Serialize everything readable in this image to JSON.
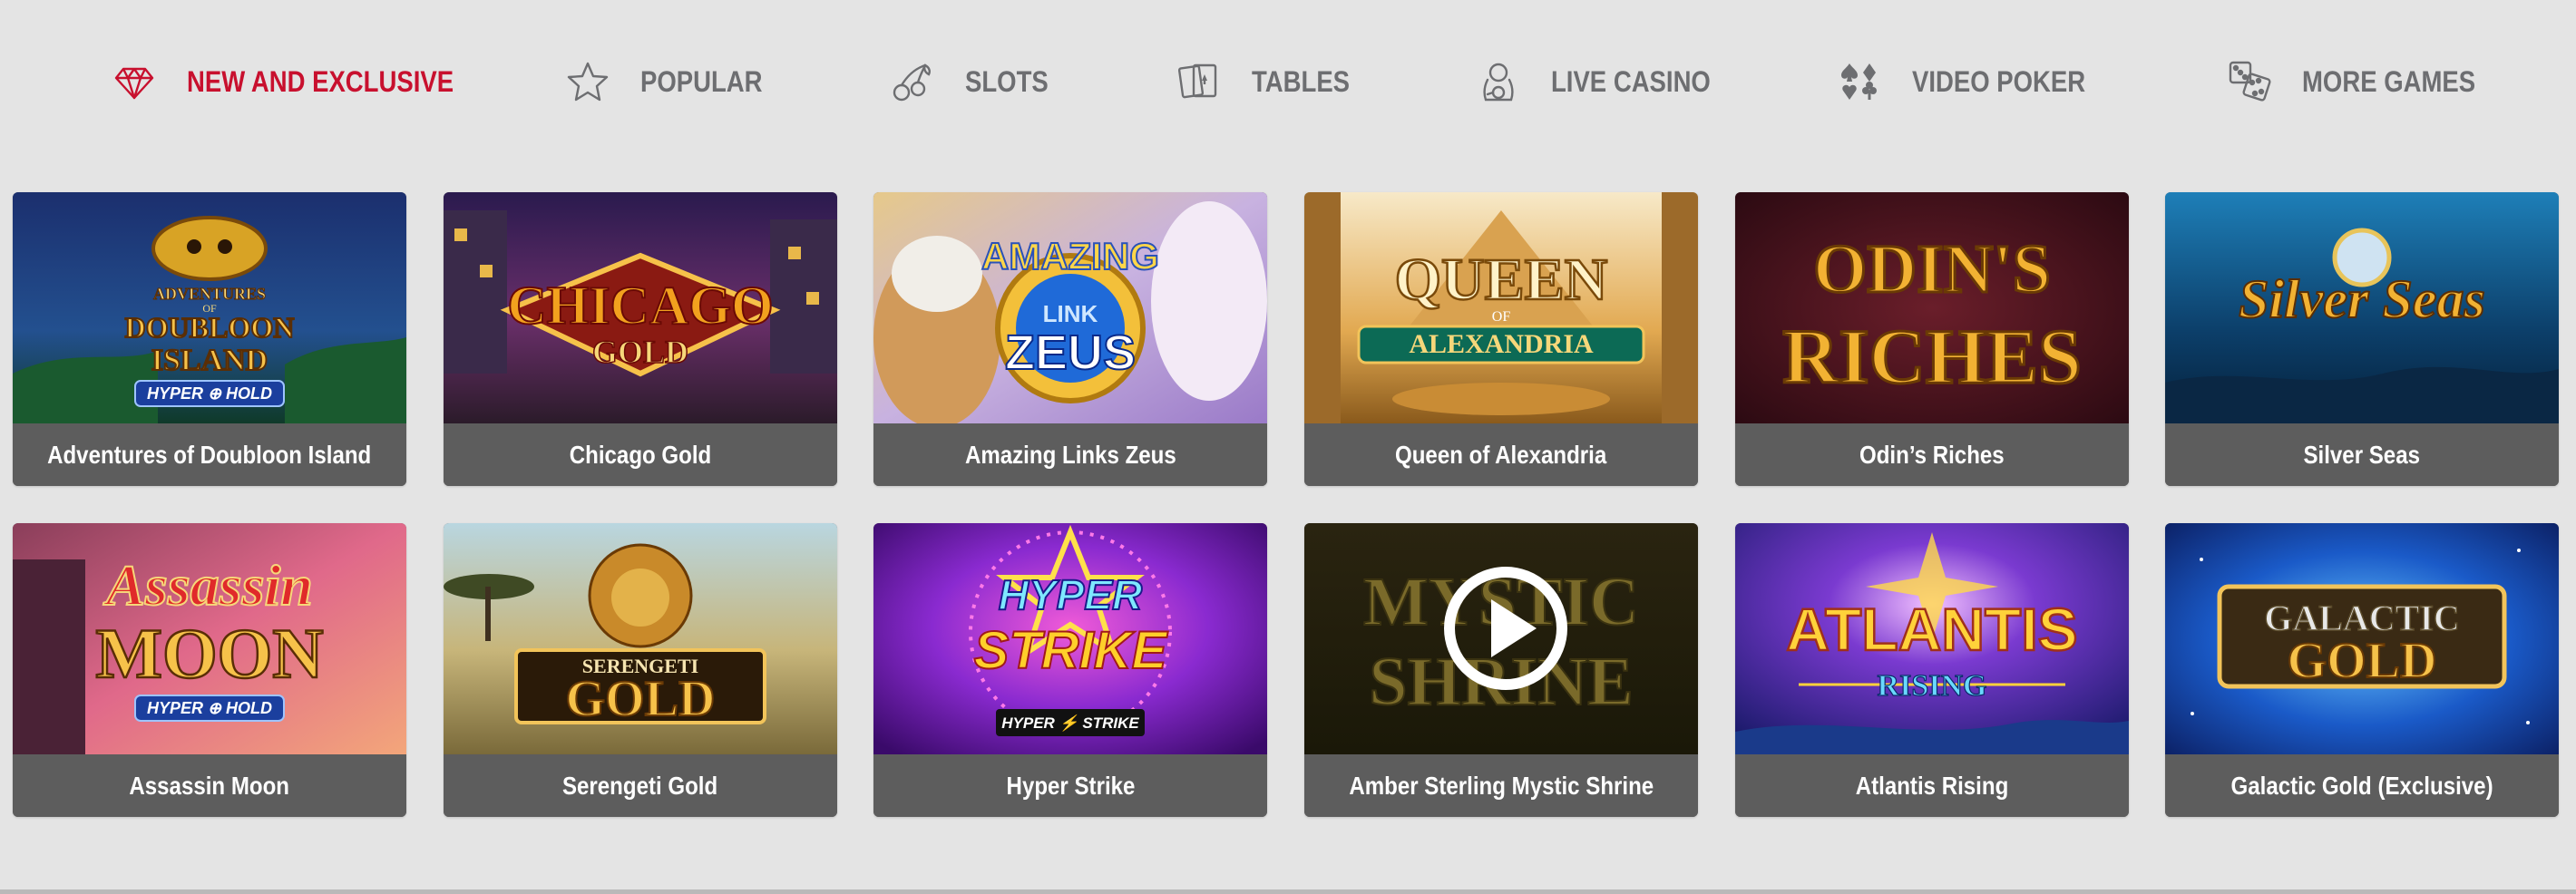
{
  "nav": {
    "items": [
      {
        "label": "NEW AND EXCLUSIVE",
        "icon": "diamond-icon",
        "active": true
      },
      {
        "label": "POPULAR",
        "icon": "star-icon",
        "active": false
      },
      {
        "label": "SLOTS",
        "icon": "cherries-icon",
        "active": false
      },
      {
        "label": "TABLES",
        "icon": "playing-cards-icon",
        "active": false
      },
      {
        "label": "LIVE CASINO",
        "icon": "live-dealer-icon",
        "active": false
      },
      {
        "label": "VIDEO POKER",
        "icon": "card-suits-icon",
        "active": false
      },
      {
        "label": "MORE GAMES",
        "icon": "dice-icon",
        "active": false
      }
    ]
  },
  "colors": {
    "active": "#c8102e",
    "inactive": "#6d6e71",
    "caption_bg": "#5d5d5d",
    "page_bg": "#e4e4e4"
  },
  "games": [
    {
      "title": "Adventures of Doubloon Island",
      "art": "ADVENTURES OF DOUBLOON ISLAND",
      "badge": "HYPER HOLD"
    },
    {
      "title": "Chicago Gold",
      "art": "CHICAGO GOLD",
      "badge": ""
    },
    {
      "title": "Amazing Links Zeus",
      "art": "AMAZING LINK ZEUS",
      "badge": ""
    },
    {
      "title": "Queen of Alexandria",
      "art": "QUEEN OF ALEXANDRIA",
      "badge": ""
    },
    {
      "title": "Odin’s Riches",
      "art": "ODIN'S RICHES",
      "badge": ""
    },
    {
      "title": "Silver Seas",
      "art": "Silver Seas",
      "badge": ""
    },
    {
      "title": "Assassin Moon",
      "art": "Assassin MOON",
      "badge": "HYPER HOLD"
    },
    {
      "title": "Serengeti Gold",
      "art": "SERENGETI GOLD",
      "badge": ""
    },
    {
      "title": "Hyper Strike",
      "art": "HYPER STRIKE",
      "badge": "HYPER STRIKE"
    },
    {
      "title": "Amber Sterling Mystic Shrine",
      "art": "MYSTIC SHRINE",
      "badge": "",
      "play_overlay": "play-icon"
    },
    {
      "title": "Atlantis Rising",
      "art": "ATLANTIS RISING",
      "badge": ""
    },
    {
      "title": "Galactic Gold (Exclusive)",
      "art": "GALACTIC GOLD",
      "badge": ""
    }
  ]
}
